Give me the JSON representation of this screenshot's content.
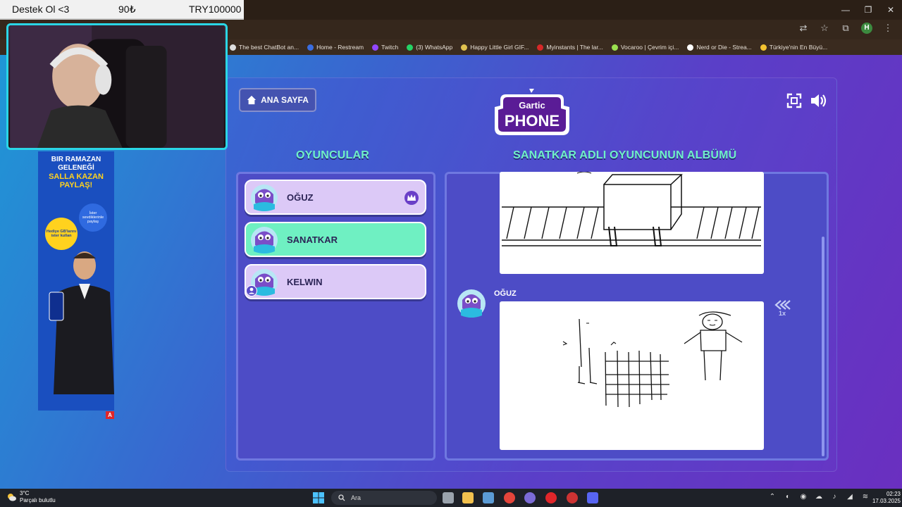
{
  "donation": {
    "user": "Destek Ol <3",
    "amount": "90₺",
    "goal": "TRY100000"
  },
  "bookmarks": [
    {
      "label": "The best ChatBot an...",
      "color": "#dddddd"
    },
    {
      "label": "Home - Restream",
      "color": "#3a6de0"
    },
    {
      "label": "Twitch",
      "color": "#9146ff"
    },
    {
      "label": "(3) WhatsApp",
      "color": "#25d366"
    },
    {
      "label": "Happy Little Girl GIF...",
      "color": "#e0c24f"
    },
    {
      "label": "Myinstants | The lar...",
      "color": "#d62828"
    },
    {
      "label": "Vocaroo | Çevrim içi...",
      "color": "#9be04f"
    },
    {
      "label": "Nerd or Die - Strea...",
      "color": "#ffffff"
    },
    {
      "label": "Türkiye'nin En Büyü...",
      "color": "#f2c230"
    }
  ],
  "profile_initial": "H",
  "game": {
    "home_label": "ANA SAYFA",
    "logo_top": "Gartic",
    "logo_bottom": "PHONE",
    "players_heading": "OYUNCULAR",
    "album_heading": "SANATKAR ADLI OYUNCUNUN ALBÜMÜ",
    "players": [
      {
        "name": "OĞUZ",
        "host": true,
        "active": false
      },
      {
        "name": "SANATKAR",
        "host": false,
        "active": true
      },
      {
        "name": "KELWIN",
        "host": false,
        "active": false
      }
    ],
    "album_author": "OĞUZ",
    "speed_label": "1x"
  },
  "ad": {
    "line1": "BIR RAMAZAN GELENEĞİ",
    "line2": "SALLA KAZAN PAYLAŞ!",
    "bubble1": "İster sevdiklerinle paylaş",
    "bubble2": "Hediye GB'larını ister kullan"
  },
  "taskbar": {
    "temperature": "3°C",
    "weather_desc": "Parçalı bulutlu",
    "search_placeholder": "Ara",
    "time": "02:23",
    "date": "17.03.2025"
  },
  "colors": {
    "accent_green": "#6ff0c7",
    "panel": "#4d4cc6",
    "player_card": "#dcc9f7",
    "active_card": "#6ff0c2"
  }
}
